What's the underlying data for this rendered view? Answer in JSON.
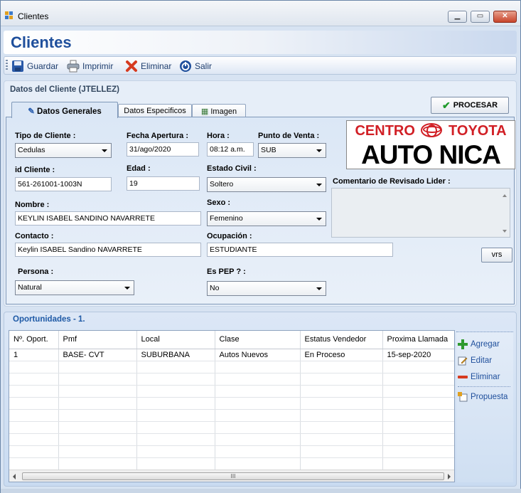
{
  "window": {
    "title": "Clientes"
  },
  "header": {
    "title": "Clientes"
  },
  "toolbar": {
    "guardar": "Guardar",
    "imprimir": "Imprimir",
    "eliminar": "Eliminar",
    "salir": "Salir"
  },
  "panel": {
    "title": "Datos del Cliente (JTELLEZ)",
    "procesar": "PROCESAR",
    "tabs": [
      "Datos Generales",
      "Datos Especificos",
      "Imagen"
    ]
  },
  "form": {
    "tipo_cliente": {
      "label": "Tipo de Cliente :",
      "value": "Cedulas"
    },
    "fecha_apertura": {
      "label": "Fecha Apertura :",
      "value": "31/ago/2020"
    },
    "hora": {
      "label": "Hora :",
      "value": "08:12 a.m."
    },
    "punto_venta": {
      "label": "Punto de Venta :",
      "value": "SUB"
    },
    "id_cliente": {
      "label": "id Cliente :",
      "value": "561-261001-1003N"
    },
    "edad": {
      "label": "Edad :",
      "value": "19"
    },
    "estado_civil": {
      "label": "Estado Civil :",
      "value": "Soltero"
    },
    "comentario": {
      "label": "Comentario de Revisado Lider :",
      "value": ""
    },
    "nombre": {
      "label": "Nombre :",
      "value": "KEYLIN ISABEL SANDINO NAVARRETE"
    },
    "sexo": {
      "label": "Sexo :",
      "value": "Femenino"
    },
    "contacto": {
      "label": "Contacto :",
      "value": "Keylin ISABEL Sandino NAVARRETE"
    },
    "ocupacion": {
      "label": "Ocupación :",
      "value": "ESTUDIANTE"
    },
    "persona": {
      "label": "Persona :",
      "value": "Natural"
    },
    "es_pep": {
      "label": "Es PEP ? :",
      "value": "No"
    },
    "vrs_button": "vrs"
  },
  "logo": {
    "line1_left": "CENTRO",
    "line1_right": "TOYOTA",
    "line2": "AUTO NICA"
  },
  "opportunities": {
    "title": "Oportunidades - 1.",
    "columns": [
      "Nº. Oport.",
      "Pmf",
      "Local",
      "Clase",
      "Estatus Vendedor",
      "Proxima Llamada"
    ],
    "rows": [
      [
        "1",
        "BASE- CVT",
        "SUBURBANA",
        "Autos Nuevos",
        "En Proceso",
        "15-sep-2020"
      ]
    ],
    "scroll_thumb": "III",
    "actions": {
      "agregar": "Agregar",
      "editar": "Editar",
      "eliminar": "Eliminar",
      "propuesta": "Propuesta"
    }
  },
  "colors": {
    "accent": "#1f4f9c",
    "brand_red": "#d11f25",
    "panel_bg": "#e6eef8"
  }
}
